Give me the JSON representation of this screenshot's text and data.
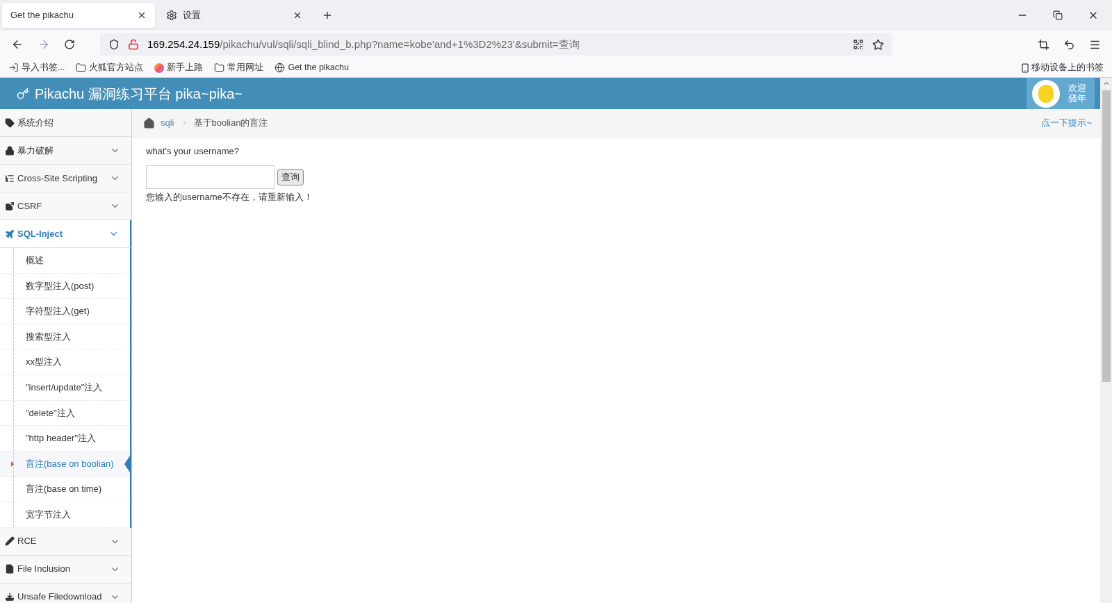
{
  "browser": {
    "tabs": [
      {
        "title": "Get the pikachu",
        "selected": true
      },
      {
        "title": "设置",
        "selected": false
      }
    ],
    "url": {
      "host": "169.254.24.159",
      "path": "/pikachu/vul/sqli/sqli_blind_b.php?name=kobe'and+1%3D2%23'&submit=查询"
    },
    "bookmarks": [
      "导入书签...",
      "火狐官方站点",
      "新手上路",
      "常用网址",
      "Get the pikachu"
    ],
    "mobile_bookmarks": "移动设备上的书签"
  },
  "header": {
    "title": "Pikachu 漏洞练习平台 pika~pika~",
    "welcome": [
      "欢迎",
      "骚年"
    ]
  },
  "sidebar": {
    "items": [
      {
        "label": "系统介绍",
        "selected": false
      },
      {
        "label": "暴力破解",
        "expanded": false,
        "selected": false
      },
      {
        "label": "Cross-Site Scripting",
        "expanded": false,
        "selected": false
      },
      {
        "label": "CSRF",
        "expanded": false,
        "selected": false
      },
      {
        "label": "SQL-Inject",
        "expanded": true,
        "selected": true,
        "children": [
          {
            "label": "概述",
            "selected": false
          },
          {
            "label": "数字型注入(post)",
            "selected": false
          },
          {
            "label": "字符型注入(get)",
            "selected": false
          },
          {
            "label": "搜索型注入",
            "selected": false
          },
          {
            "label": "xx型注入",
            "selected": false
          },
          {
            "label": "\"insert/update\"注入",
            "selected": false
          },
          {
            "label": "\"delete\"注入",
            "selected": false
          },
          {
            "label": "\"http header\"注入",
            "selected": false
          },
          {
            "label": "盲注(base on boolian)",
            "selected": true
          },
          {
            "label": "盲注(base on time)",
            "selected": false
          },
          {
            "label": "宽字节注入",
            "selected": false
          }
        ]
      },
      {
        "label": "RCE",
        "expanded": false,
        "selected": false
      },
      {
        "label": "File Inclusion",
        "expanded": false,
        "selected": false
      },
      {
        "label": "Unsafe Filedownload",
        "expanded": false,
        "selected": false
      }
    ]
  },
  "breadcrumb": {
    "items": [
      "sqli",
      "基于boolian的盲注"
    ],
    "hint": "点一下提示~"
  },
  "form": {
    "question": "what's your username?",
    "button": "查询",
    "message": "您输入的username不存在，请重新输入！"
  }
}
